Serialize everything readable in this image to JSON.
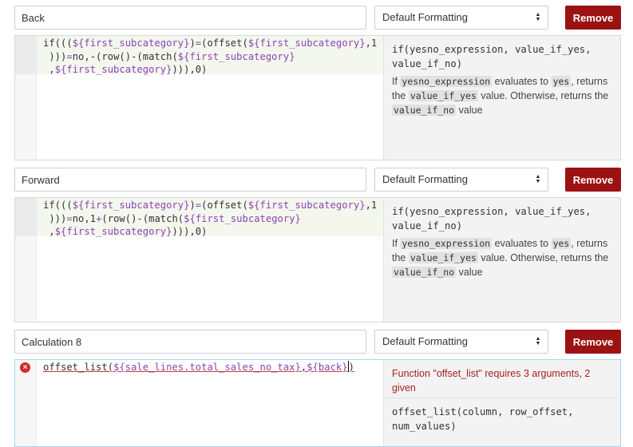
{
  "calculations": [
    {
      "name": "Back",
      "format": "Default Formatting",
      "remove_label": "Remove",
      "help": {
        "signature_1": "if(yesno_expression, value_if_yes,",
        "signature_2": "value_if_no)",
        "desc_1": "If ",
        "tok_1": "yesno_expression",
        "desc_2": " evaluates to ",
        "tok_2": "yes",
        "desc_3": ", returns",
        "desc_4": "the ",
        "tok_3": "value_if_yes",
        "desc_5": " value. Otherwise, returns the",
        "tok_4": "value_if_no",
        "desc_6": " value"
      }
    },
    {
      "name": "Forward",
      "format": "Default Formatting",
      "remove_label": "Remove",
      "help": {
        "signature_1": "if(yesno_expression, value_if_yes,",
        "signature_2": "value_if_no)",
        "desc_1": "If ",
        "tok_1": "yesno_expression",
        "desc_2": " evaluates to ",
        "tok_2": "yes",
        "desc_3": ", returns",
        "desc_4": "the ",
        "tok_3": "value_if_yes",
        "desc_5": " value. Otherwise, returns the",
        "tok_4": "value_if_no",
        "desc_6": " value"
      }
    },
    {
      "name": "Calculation 8",
      "format": "Default Formatting",
      "remove_label": "Remove",
      "error_1": "Function \"offset_list\" requires 3 arguments, 2",
      "error_2": "given",
      "help": {
        "signature_1": "offset_list(column, row_offset,",
        "signature_2": "num_values)"
      }
    }
  ],
  "code": {
    "c1": {
      "t1": "if(((",
      "v1": "${first_subcategory}",
      "t2": ")",
      "o1": "=",
      "t3": "(offset(",
      "v2": "${first_subcategory}",
      "t4": ",1",
      "t5": ")))",
      "o2": "=",
      "t6": "no,-(row()-(match(",
      "v3": "${first_subcategory}",
      "t7": ",",
      "v4": "${first_subcategory}",
      "t8": "))),0)"
    },
    "c2": {
      "t1": "if(((",
      "v1": "${first_subcategory}",
      "t2": ")",
      "o1": "=",
      "t3": "(offset(",
      "v2": "${first_subcategory}",
      "t4": ",1",
      "t5": ")))",
      "o2": "=",
      "t6": "no,1",
      "o3": "+",
      "t6b": "(row()-(match(",
      "v3": "${first_subcategory}",
      "t7": ",",
      "v4": "${first_subcategory}",
      "t8": "))),0)"
    },
    "c3": {
      "t1": "offset_list(",
      "v1": "${sale_lines.total_sales_no_tax}",
      "t2": ",",
      "v2": "${back}",
      "t3": ")"
    }
  },
  "icons": {
    "select_arrows": "up-down-arrows-icon",
    "error": "error-circle-x-icon"
  },
  "colors": {
    "remove_button": "#9b1212",
    "variable": "#8c44b3",
    "error_text": "#a62020"
  }
}
